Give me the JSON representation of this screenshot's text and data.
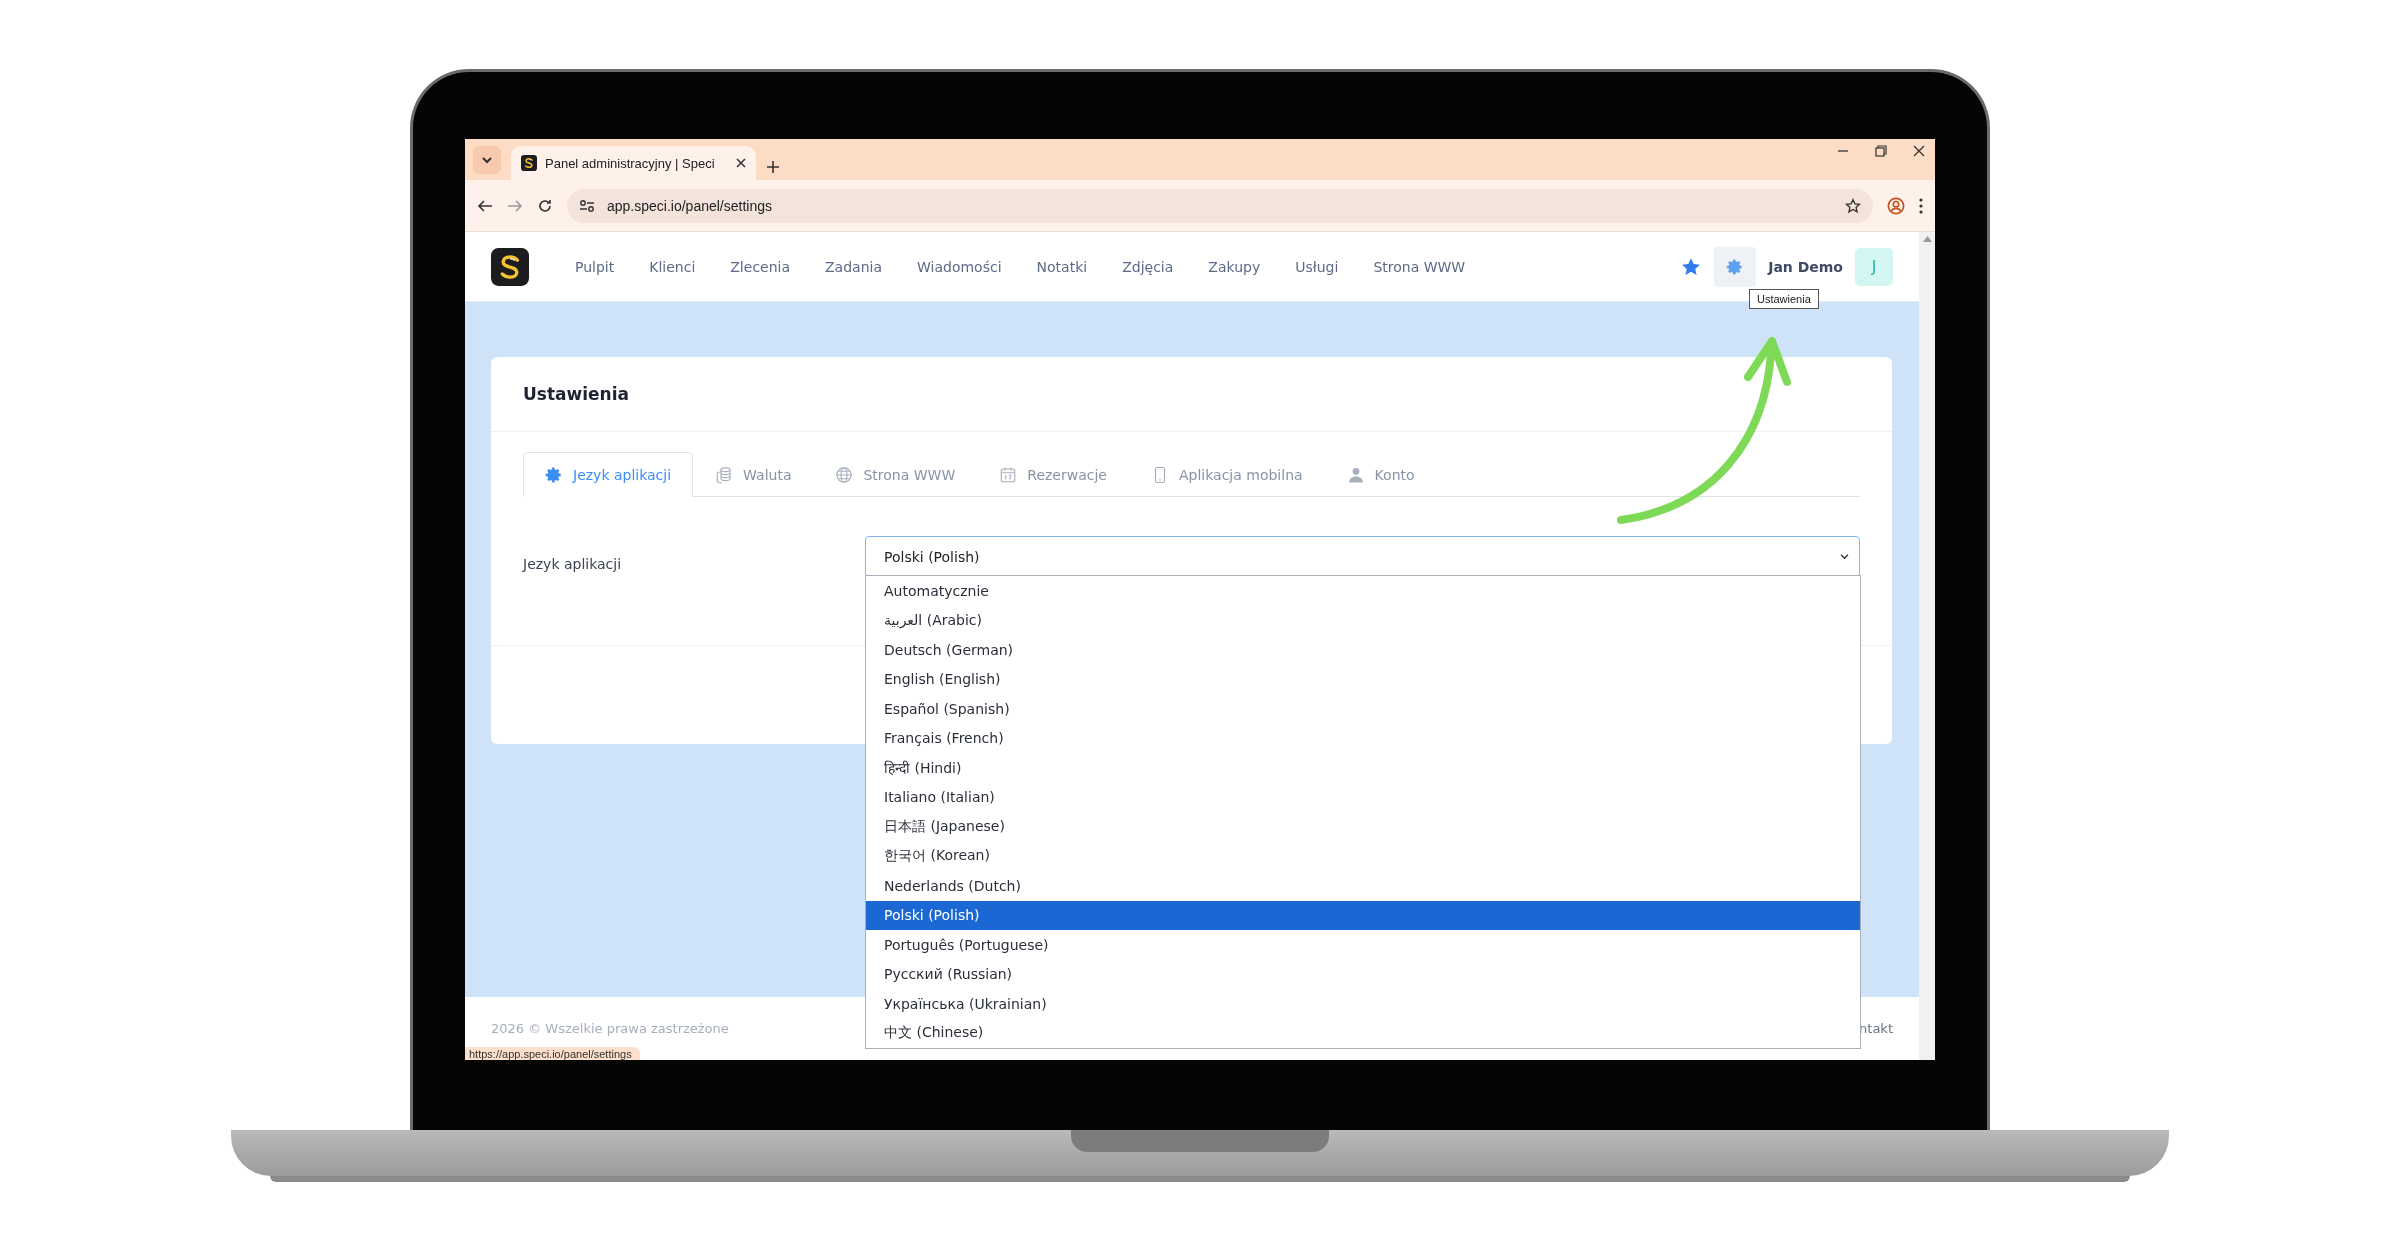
{
  "browser": {
    "tab_title": "Panel administracyjny | Speci",
    "url": "app.speci.io/panel/settings",
    "status_url": "https://app.speci.io/panel/settings"
  },
  "nav": {
    "items": [
      "Pulpit",
      "Klienci",
      "Zlecenia",
      "Zadania",
      "Wiadomości",
      "Notatki",
      "Zdjęcia",
      "Zakupy",
      "Usługi",
      "Strona WWW"
    ],
    "user": "Jan Demo",
    "avatar": "J",
    "tooltip": "Ustawienia"
  },
  "card": {
    "title": "Ustawienia",
    "tabs": [
      {
        "label": "Jezyk aplikacji",
        "selected": true
      },
      {
        "label": "Waluta",
        "selected": false
      },
      {
        "label": "Strona WWW",
        "selected": false
      },
      {
        "label": "Rezerwacje",
        "selected": false
      },
      {
        "label": "Aplikacja mobilna",
        "selected": false
      },
      {
        "label": "Konto",
        "selected": false
      }
    ],
    "field_label": "Jezyk aplikacji",
    "select_value": "Polski (Polish)",
    "options": [
      {
        "label": "Automatycznie",
        "selected": false
      },
      {
        "label": "العربية (Arabic)",
        "selected": false
      },
      {
        "label": "Deutsch (German)",
        "selected": false
      },
      {
        "label": "English (English)",
        "selected": false
      },
      {
        "label": "Español (Spanish)",
        "selected": false
      },
      {
        "label": "Français (French)",
        "selected": false
      },
      {
        "label": "हिन्दी (Hindi)",
        "selected": false
      },
      {
        "label": "Italiano (Italian)",
        "selected": false
      },
      {
        "label": "日本語 (Japanese)",
        "selected": false
      },
      {
        "label": "한국어 (Korean)",
        "selected": false
      },
      {
        "label": "Nederlands (Dutch)",
        "selected": false
      },
      {
        "label": "Polski (Polish)",
        "selected": true
      },
      {
        "label": "Português (Portuguese)",
        "selected": false
      },
      {
        "label": "Русский (Russian)",
        "selected": false
      },
      {
        "label": "Українська (Ukrainian)",
        "selected": false
      },
      {
        "label": "中文 (Chinese)",
        "selected": false
      }
    ]
  },
  "footer": {
    "copyright": "2026 © Wszelkie prawa zastrzeżone",
    "link": "ntakt"
  }
}
